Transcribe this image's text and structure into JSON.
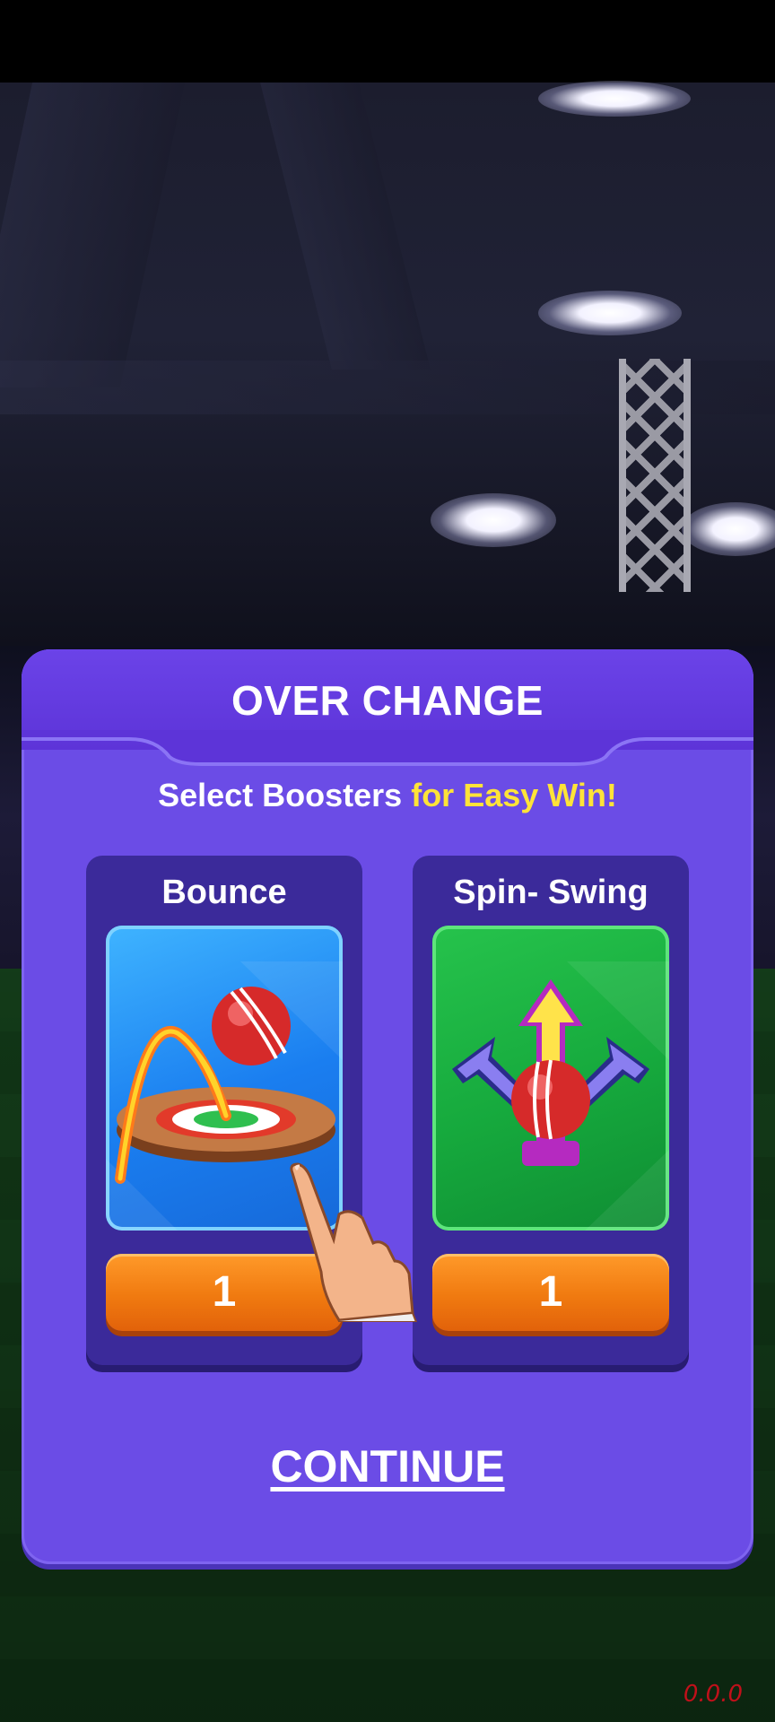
{
  "dialog": {
    "title": "OVER CHANGE",
    "subtitle_prefix": "Select Boosters ",
    "subtitle_highlight": "for Easy Win!",
    "continue_label": "CONTINUE"
  },
  "boosters": [
    {
      "label": "Bounce",
      "count": "1",
      "icon": "bounce-ball-icon",
      "tile_color": "#1a7ef0"
    },
    {
      "label": "Spin- Swing",
      "count": "1",
      "icon": "spin-swing-arrows-icon",
      "tile_color": "#16a93d"
    }
  ],
  "version": "0.0.0",
  "colors": {
    "dialog_bg": "#6b4ce6",
    "highlight": "#ffe338",
    "button_orange": "#f07a10"
  }
}
